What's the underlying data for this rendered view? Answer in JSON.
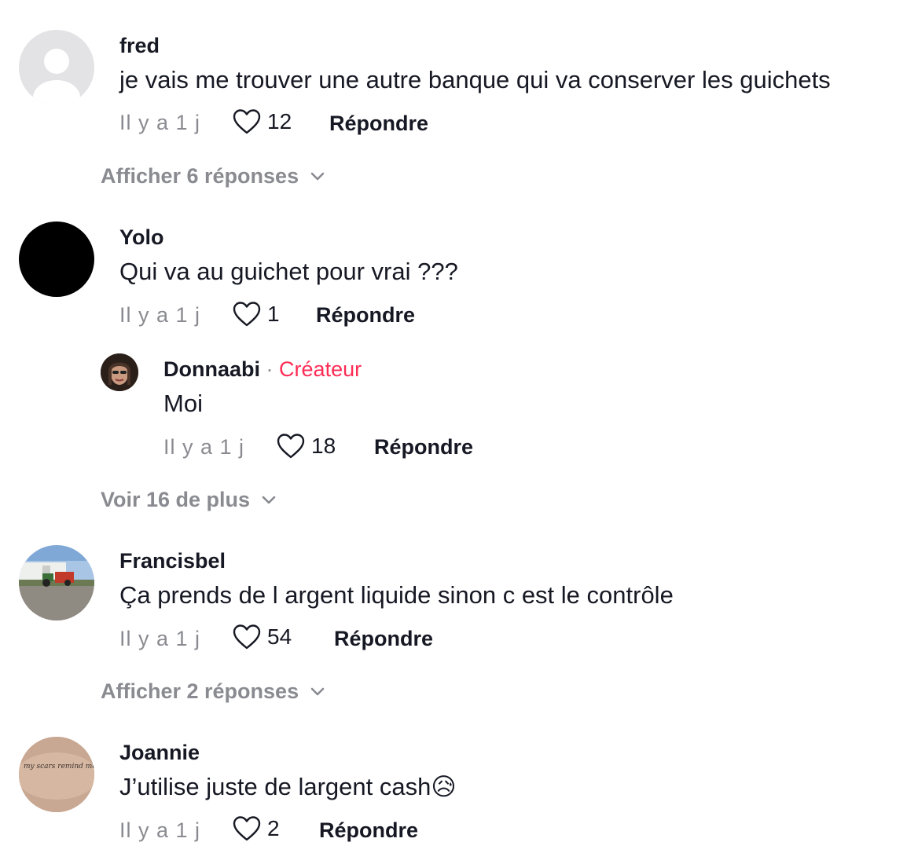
{
  "comments": [
    {
      "username": "fred",
      "text": "je vais me trouver une autre banque qui va conserver les guichets",
      "time": "Il y a 1 j",
      "likes": "12",
      "reply_label": "Répondre",
      "avatar": "default-avatar-icon",
      "view_replies": "Afficher 6 réponses"
    },
    {
      "username": "Yolo",
      "text": "Qui va au guichet pour vrai ???",
      "time": "Il y a 1 j",
      "likes": "1",
      "reply_label": "Répondre",
      "avatar": "black-avatar",
      "reply": {
        "username": "Donnaabi",
        "separator": "·",
        "badge": "Créateur",
        "text": "Moi",
        "time": "Il y a 1 j",
        "likes": "18",
        "reply_label": "Répondre"
      },
      "view_more": "Voir 16 de plus"
    },
    {
      "username": "Francisbel",
      "text": "Ça prends de l argent liquide sinon c est le contrôle",
      "time": "Il y a 1 j",
      "likes": "54",
      "reply_label": "Répondre",
      "avatar": "farm-photo-avatar",
      "view_replies": "Afficher 2 réponses"
    },
    {
      "username": "Joannie",
      "text": "J’utilise juste de largent cash",
      "emoji": "😥",
      "time": "Il y a 1 j",
      "likes": "2",
      "reply_label": "Répondre",
      "avatar": "tattoo-photo-avatar",
      "avatar_text": "my scars remind me that the past is real"
    }
  ],
  "colors": {
    "text": "#161823",
    "muted": "#8a8b91",
    "creator": "#fe2c55"
  }
}
